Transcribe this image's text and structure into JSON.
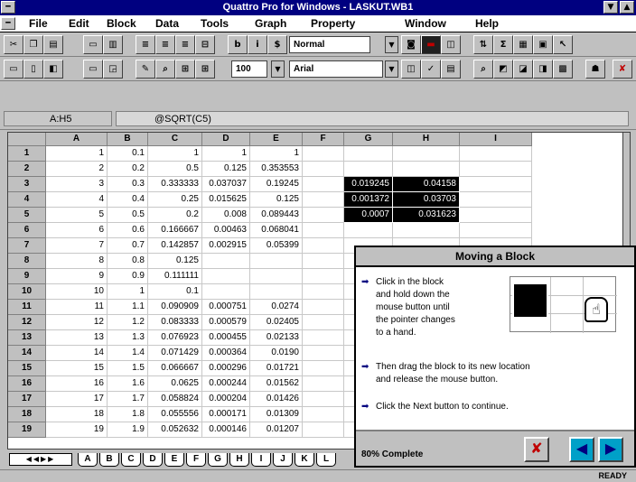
{
  "window": {
    "title": "Quattro Pro for Windows - LASKUT.WB1"
  },
  "menu": [
    "File",
    "Edit",
    "Block",
    "Data",
    "Tools",
    "Graph",
    "Property",
    "Window",
    "Help"
  ],
  "toolbar": {
    "style_value": "Normal",
    "zoom_value": "100",
    "font_value": "Arial"
  },
  "input_line": {
    "cell_ref": "A:H5",
    "content": "@SQRT(C5)"
  },
  "columns": [
    "A",
    "B",
    "C",
    "D",
    "E",
    "F",
    "G",
    "H",
    "I"
  ],
  "rows": [
    {
      "n": "1",
      "a": "1",
      "b": "0.1",
      "c": "1",
      "d": "1",
      "e": "1"
    },
    {
      "n": "2",
      "a": "2",
      "b": "0.2",
      "c": "0.5",
      "d": "0.125",
      "e": "0.353553"
    },
    {
      "n": "3",
      "a": "3",
      "b": "0.3",
      "c": "0.333333",
      "d": "0.037037",
      "e": "0.19245",
      "g": "0.019245",
      "h": "0.04158"
    },
    {
      "n": "4",
      "a": "4",
      "b": "0.4",
      "c": "0.25",
      "d": "0.015625",
      "e": "0.125",
      "g": "0.001372",
      "h": "0.03703"
    },
    {
      "n": "5",
      "a": "5",
      "b": "0.5",
      "c": "0.2",
      "d": "0.008",
      "e": "0.089443",
      "g": "0.0007",
      "h": "0.031623"
    },
    {
      "n": "6",
      "a": "6",
      "b": "0.6",
      "c": "0.166667",
      "d": "0.00463",
      "e": "0.068041"
    },
    {
      "n": "7",
      "a": "7",
      "b": "0.7",
      "c": "0.142857",
      "d": "0.002915",
      "e": "0.05399"
    },
    {
      "n": "8",
      "a": "8",
      "b": "0.8",
      "c": "0.125"
    },
    {
      "n": "9",
      "a": "9",
      "b": "0.9",
      "c": "0.111111"
    },
    {
      "n": "10",
      "a": "10",
      "b": "1",
      "c": "0.1"
    },
    {
      "n": "11",
      "a": "11",
      "b": "1.1",
      "c": "0.090909",
      "d": "0.000751",
      "e": "0.0274"
    },
    {
      "n": "12",
      "a": "12",
      "b": "1.2",
      "c": "0.083333",
      "d": "0.000579",
      "e": "0.02405"
    },
    {
      "n": "13",
      "a": "13",
      "b": "1.3",
      "c": "0.076923",
      "d": "0.000455",
      "e": "0.02133"
    },
    {
      "n": "14",
      "a": "14",
      "b": "1.4",
      "c": "0.071429",
      "d": "0.000364",
      "e": "0.0190"
    },
    {
      "n": "15",
      "a": "15",
      "b": "1.5",
      "c": "0.066667",
      "d": "0.000296",
      "e": "0.01721"
    },
    {
      "n": "16",
      "a": "16",
      "b": "1.6",
      "c": "0.0625",
      "d": "0.000244",
      "e": "0.01562"
    },
    {
      "n": "17",
      "a": "17",
      "b": "1.7",
      "c": "0.058824",
      "d": "0.000204",
      "e": "0.01426"
    },
    {
      "n": "18",
      "a": "18",
      "b": "1.8",
      "c": "0.055556",
      "d": "0.000171",
      "e": "0.01309"
    },
    {
      "n": "19",
      "a": "19",
      "b": "1.9",
      "c": "0.052632",
      "d": "0.000146",
      "e": "0.01207"
    }
  ],
  "sheet_tabs": [
    "A",
    "B",
    "C",
    "D",
    "E",
    "F",
    "G",
    "H",
    "I",
    "J",
    "K",
    "L"
  ],
  "status": {
    "mode": "READY"
  },
  "coach": {
    "title": "Moving a Block",
    "step1": "Click in the block\nand hold down the\nmouse button until\nthe pointer changes\nto a hand.",
    "step2": "Then drag the block to its new location\nand release the mouse button.",
    "step3": "Click the Next button to continue.",
    "complete": "80% Complete",
    "progress": 0.8
  }
}
